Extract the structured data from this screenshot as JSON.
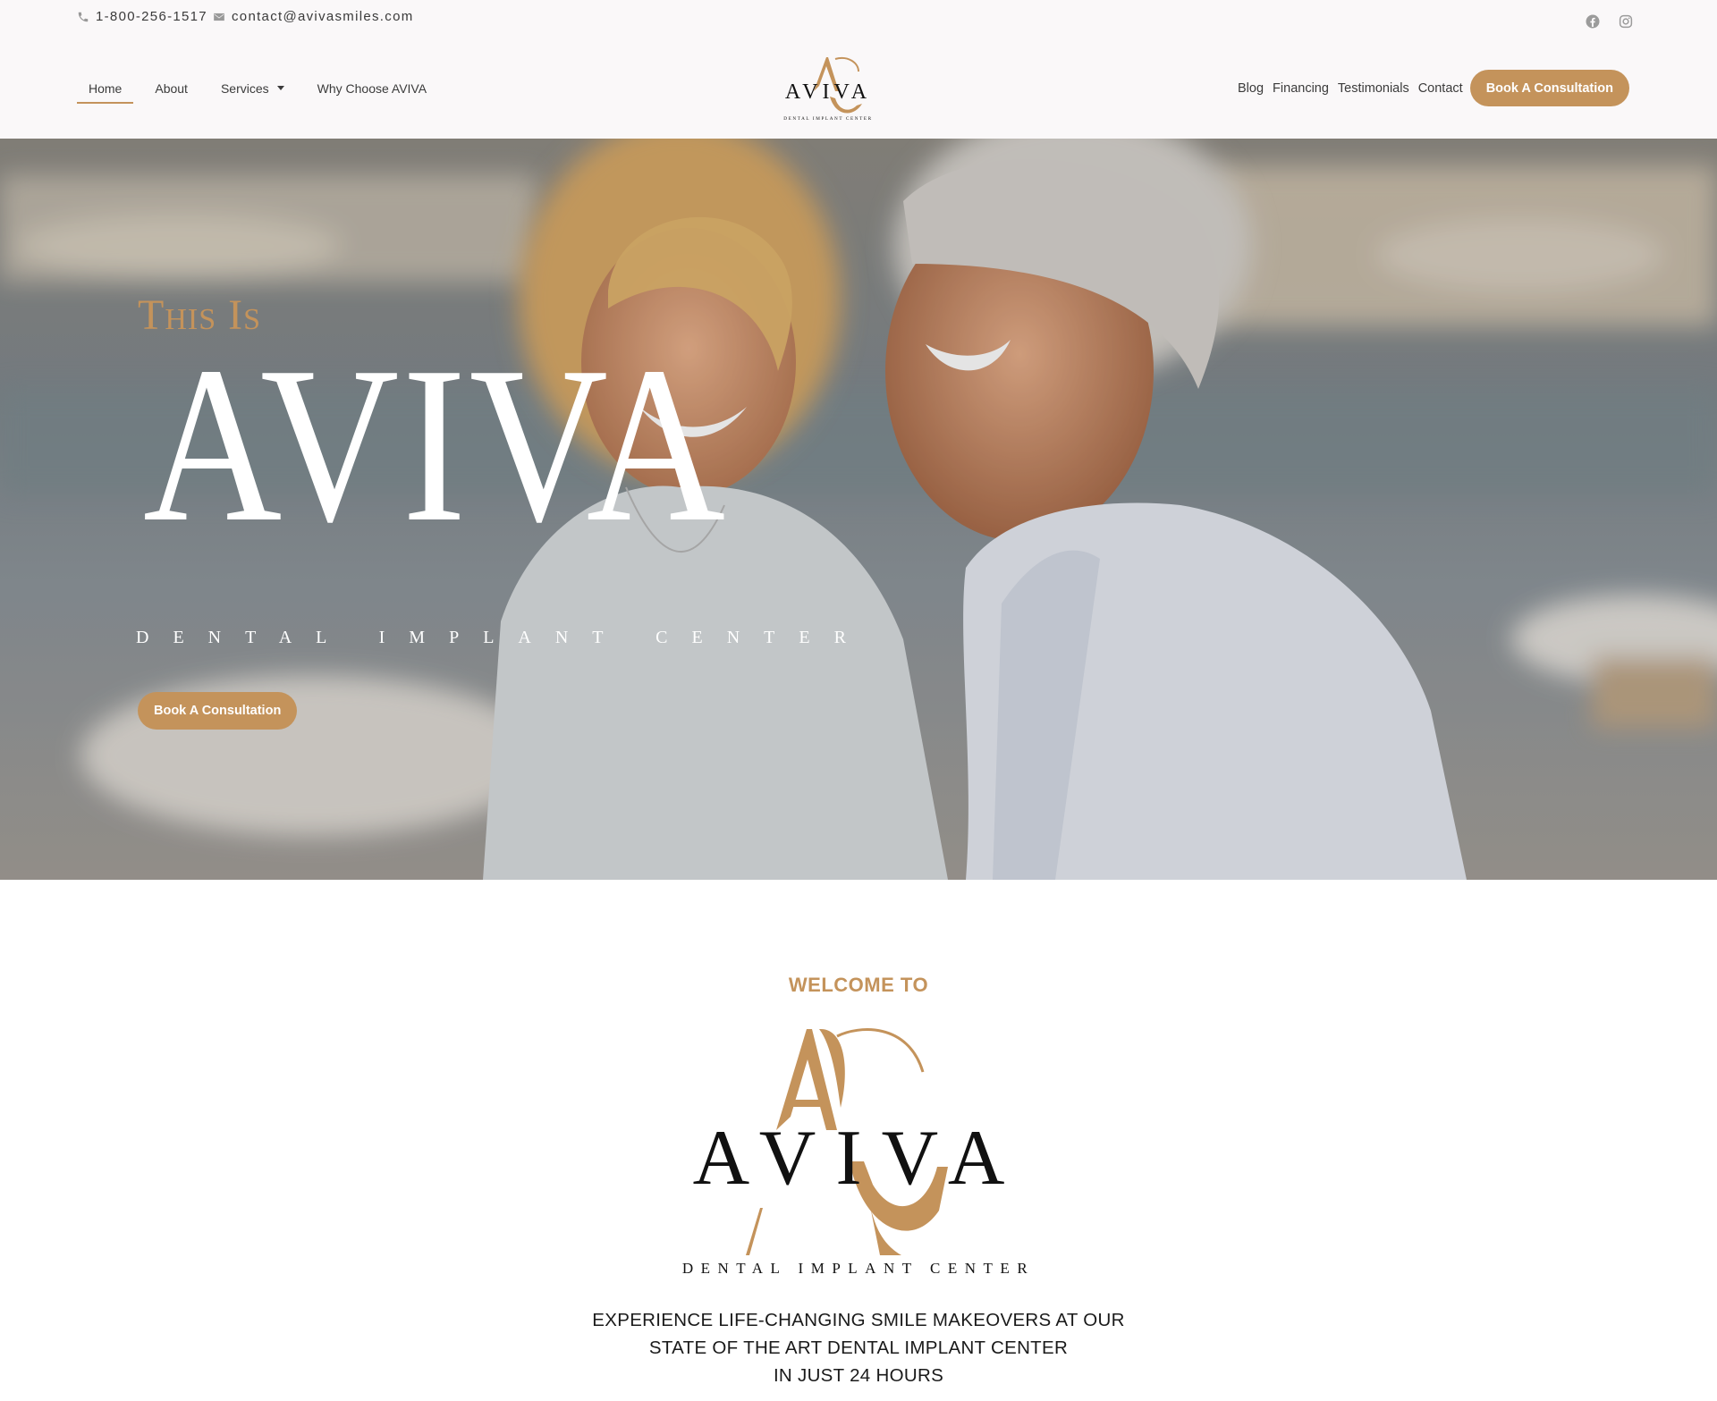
{
  "topbar": {
    "phone": "1-800-256-1517",
    "email": "contact@avivasmiles.com",
    "social": [
      {
        "icon": "facebook-icon"
      },
      {
        "icon": "instagram-icon"
      }
    ]
  },
  "nav": {
    "left": [
      {
        "label": "Home",
        "active": true
      },
      {
        "label": "About"
      },
      {
        "label": "Services",
        "has_dropdown": true
      },
      {
        "label": "Why Choose AVIVA"
      }
    ],
    "right": [
      {
        "label": "Blog"
      },
      {
        "label": "Financing"
      },
      {
        "label": "Testimonials"
      },
      {
        "label": "Contact"
      }
    ],
    "cta": "Book A Consultation"
  },
  "logo": {
    "brand": "AVIVA",
    "tagline": "DENTAL IMPLANT CENTER",
    "monogram": "AC"
  },
  "hero": {
    "kicker": "This Is",
    "title": "AVIVA",
    "subtitle": "DENTAL IMPLANT CENTER",
    "cta": "Book A Consultation"
  },
  "welcome": {
    "kicker": "WELCOME TO",
    "lines": [
      "EXPERIENCE LIFE-CHANGING SMILE MAKEOVERS AT OUR",
      "STATE OF THE ART DENTAL IMPLANT CENTER",
      "IN JUST 24 HOURS"
    ]
  },
  "colors": {
    "accent": "#c4935b",
    "header_bg": "#faf8f9",
    "text_dark": "#1a1a1a"
  }
}
